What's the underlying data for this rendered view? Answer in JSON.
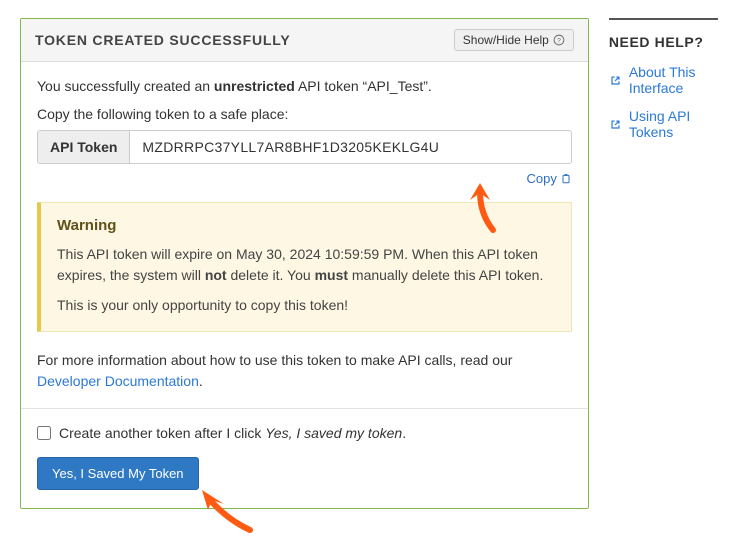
{
  "panel": {
    "title": "TOKEN CREATED SUCCESSFULLY",
    "helpBtn": "Show/Hide Help"
  },
  "intro": {
    "pre": "You successfully created an ",
    "bold": "unrestricted",
    "post": " API token “API_Test”."
  },
  "copyMsg": "Copy the following token to a safe place:",
  "token": {
    "label": "API Token",
    "value": "MZDRRPC37YLL7AR8BHF1D3205KEKLG4U"
  },
  "copyLink": "Copy",
  "warning": {
    "heading": "Warning",
    "line1": {
      "a": "This API token will expire on May 30, 2024 10:59:59 PM. When this API token expires, the system will ",
      "b": "not",
      "c": " delete it. You ",
      "d": "must",
      "e": " manually delete this API token."
    },
    "line2": "This is your only opportunity to copy this token!"
  },
  "moreInfo": {
    "pre": "For more information about how to use this token to make API calls, read our ",
    "link": "Developer Documentation",
    "post": "."
  },
  "checkbox": {
    "pre": "Create another token after I click ",
    "em": "Yes, I saved my token",
    "post": "."
  },
  "saveBtn": "Yes, I Saved My Token",
  "side": {
    "heading": "NEED HELP?",
    "links": [
      "About This Interface",
      "Using API Tokens"
    ]
  }
}
